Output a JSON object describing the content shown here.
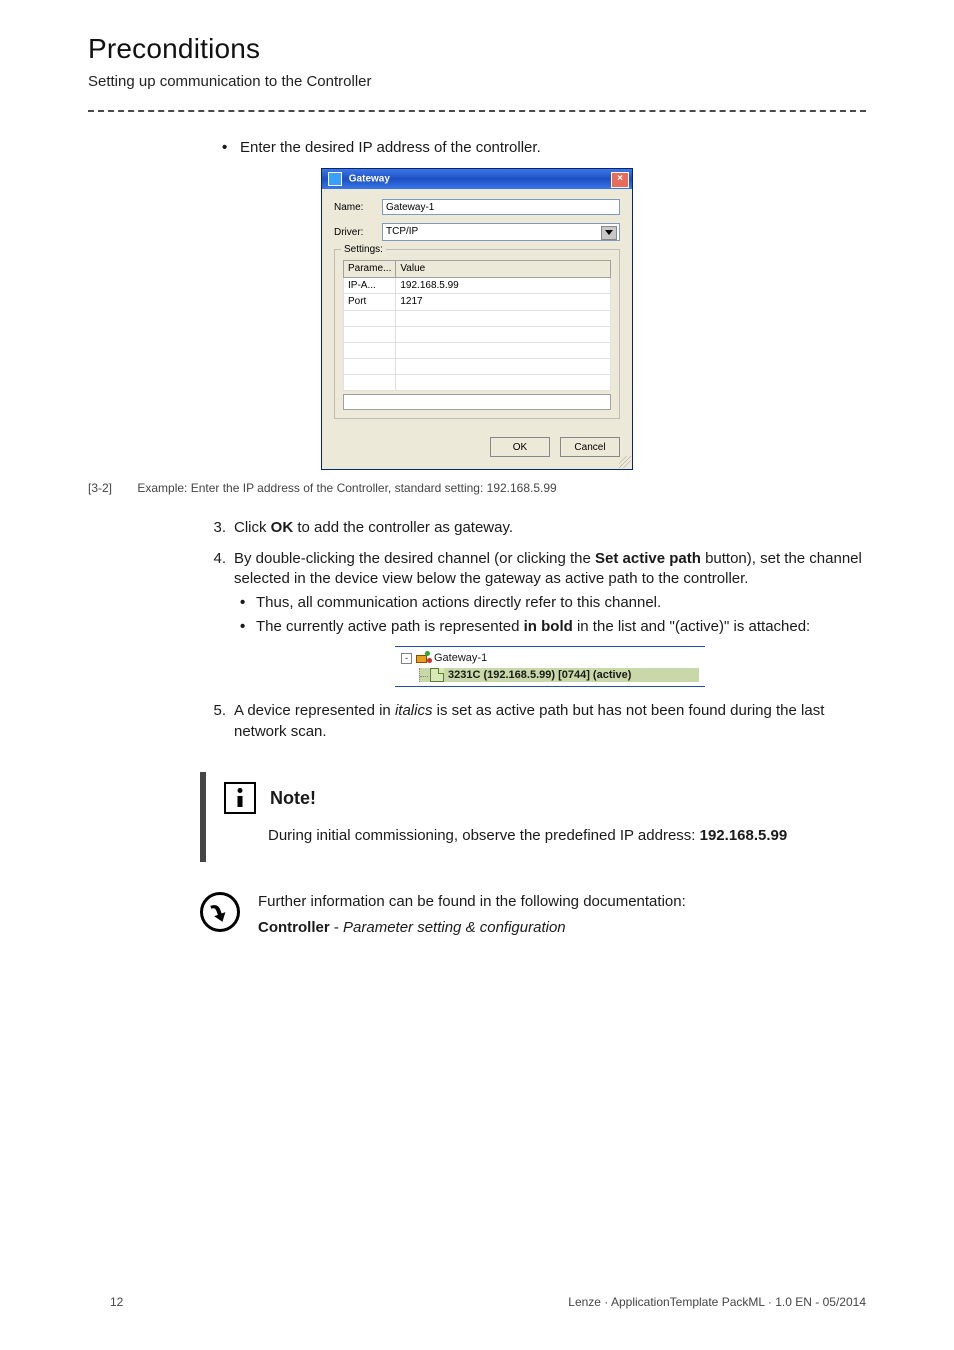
{
  "header": {
    "title": "Preconditions",
    "subtitle": "Setting up communication to the Controller"
  },
  "intro_bullet": "Enter the desired IP address of the controller.",
  "gateway_dialog": {
    "title": "Gateway",
    "name_label": "Name:",
    "name_value": "Gateway-1",
    "driver_label": "Driver:",
    "driver_value": "TCP/IP",
    "settings_label": "Settings:",
    "table": {
      "h1": "Parame...",
      "h2": "Value",
      "r1c1": "IP-A...",
      "r1c2": "192.168.5.99",
      "r2c1": "Port",
      "r2c2": "1217"
    },
    "ok": "OK",
    "cancel": "Cancel"
  },
  "caption": {
    "num": "[3-2]",
    "text": "Example: Enter the IP address of the Controller, standard setting: 192.168.5.99"
  },
  "steps": {
    "s3_pre": "Click ",
    "s3_b": "OK",
    "s3_post": " to add the controller as gateway.",
    "s4_pre": "By double-clicking the desired channel (or clicking the ",
    "s4_b": "Set active path",
    "s4_post": " button), set the channel selected in the device view below the gateway as active path to the controller.",
    "s4_sub1": "Thus, all communication actions directly refer to this channel.",
    "s4_sub2": "The currently active path is represented in bold in the list and \"(active)\" is attached:",
    "s5_pre": "A device represented in ",
    "s5_i": "italics",
    "s5_post": " is set as active path but has not been found during the last network scan."
  },
  "active_path_tree": {
    "gateway": "Gateway-1",
    "device": "3231C (192.168.5.99) [0744] (active)"
  },
  "note": {
    "title": "Note!",
    "body_pre": "During initial commissioning, observe the predefined IP address: ",
    "body_b": "192.168.5.99"
  },
  "ref": {
    "line1": "Further information can be found in the following documentation:",
    "ctrl": "Controller",
    "dash": " - ",
    "doc": "Parameter setting & configuration"
  },
  "footer": {
    "page": "12",
    "right": "Lenze · ApplicationTemplate PackML · 1.0 EN - 05/2014"
  }
}
